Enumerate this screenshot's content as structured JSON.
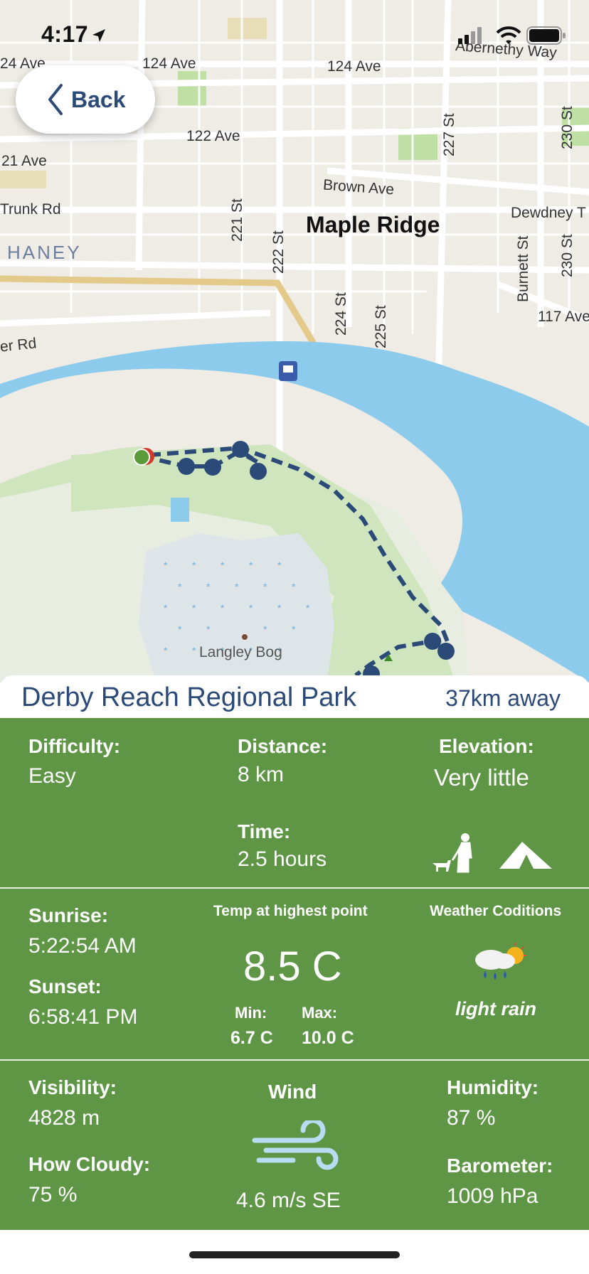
{
  "status_bar": {
    "time": "4:17"
  },
  "nav": {
    "back_label": "Back"
  },
  "map": {
    "labels": {
      "ave124_left": "24 Ave",
      "ave124_a": "124 Ave",
      "ave124_b": "124 Ave",
      "abernethy": "Abernethy Way",
      "ave122": "122 Ave",
      "ave121": "21 Ave",
      "brown": "Brown Ave",
      "trunk": "Trunk Rd",
      "dewdney": "Dewdney T",
      "maple_ridge": "Maple Ridge",
      "haney": "HANEY",
      "st221": "221 St",
      "st222": "222 St",
      "st224": "224 St",
      "st225": "225 St",
      "st227": "227 St",
      "st230_top": "230 St",
      "st230_b": "230 St",
      "burnett": "Burnett St",
      "ave117": "117 Ave",
      "rd_left": "er Rd",
      "langley_bog": "Langley Bog"
    }
  },
  "park": {
    "name": "Derby Reach Regional Park",
    "distance_away": "37km away"
  },
  "details": {
    "difficulty_label": "Difficulty:",
    "difficulty_value": "Easy",
    "distance_label": "Distance:",
    "distance_value": "8 km",
    "elevation_label": "Elevation:",
    "elevation_value": "Very little",
    "time_label": "Time:",
    "time_value": "2.5 hours"
  },
  "weather": {
    "sunrise_label": "Sunrise:",
    "sunrise_value": "5:22:54 AM",
    "sunset_label": "Sunset:",
    "sunset_value": "6:58:41 PM",
    "temp_label": "Temp at highest point",
    "temp_value": "8.5 C",
    "min_label": "Min:",
    "min_value": "6.7 C",
    "max_label": "Max:",
    "max_value": "10.0 C",
    "conditions_label": "Weather Coditions",
    "conditions_value": "light rain"
  },
  "atmosphere": {
    "visibility_label": "Visibility:",
    "visibility_value": "4828 m",
    "cloudy_label": "How Cloudy:",
    "cloudy_value": "75 %",
    "wind_label": "Wind",
    "wind_value": "4.6 m/s SE",
    "humidity_label": "Humidity:",
    "humidity_value": "87 %",
    "barometer_label": "Barometer:",
    "barometer_value": "1009 hPa"
  },
  "colors": {
    "panel_green": "#5e9645",
    "title_blue": "#2b4a78",
    "river_blue": "#8ccbec",
    "trail_navy": "#2b4a78"
  }
}
